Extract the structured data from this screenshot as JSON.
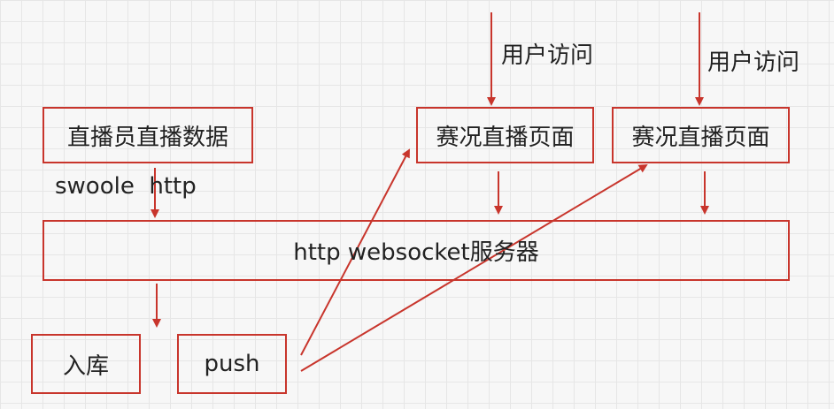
{
  "nodes": {
    "broadcaster_data": "直播员直播数据",
    "live_page_1": "赛况直播页面",
    "live_page_2": "赛况直播页面",
    "server": "http websocket服务器",
    "storage": "入库",
    "push": "push"
  },
  "labels": {
    "swoole_http": "swoole  http",
    "user_access_1": "用户访问",
    "user_access_2": "用户访问"
  },
  "colors": {
    "stroke": "#c8352c",
    "text": "#222222",
    "background": "#f7f7f7"
  }
}
